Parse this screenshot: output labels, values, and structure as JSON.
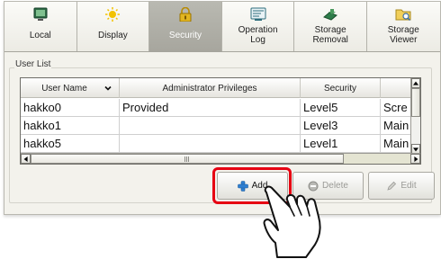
{
  "tabs": [
    {
      "label": "Local",
      "icon": "monitor-icon",
      "active": false
    },
    {
      "label": "Display",
      "icon": "sun-icon",
      "active": false
    },
    {
      "label": "Security",
      "icon": "padlock-icon",
      "active": true
    },
    {
      "label": "Operation\nLog",
      "icon": "log-icon",
      "active": false
    },
    {
      "label": "Storage\nRemoval",
      "icon": "storage-icon",
      "active": false
    },
    {
      "label": "Storage\nViewer",
      "icon": "folder-icon",
      "active": false
    }
  ],
  "user_list": {
    "title": "User List",
    "columns": [
      "User Name",
      "Administrator Privileges",
      "Security",
      ""
    ],
    "rows": [
      [
        "hakko0",
        "Provided",
        "Level5",
        "Scre"
      ],
      [
        "hakko1",
        "",
        "Level3",
        "Main"
      ],
      [
        "hakko5",
        "",
        "Level1",
        "Main"
      ]
    ]
  },
  "buttons": {
    "add": "Add",
    "delete": "Delete",
    "edit": "Edit"
  },
  "colors": {
    "highlight": "#e60012",
    "active_tab": "#a7a69e"
  }
}
